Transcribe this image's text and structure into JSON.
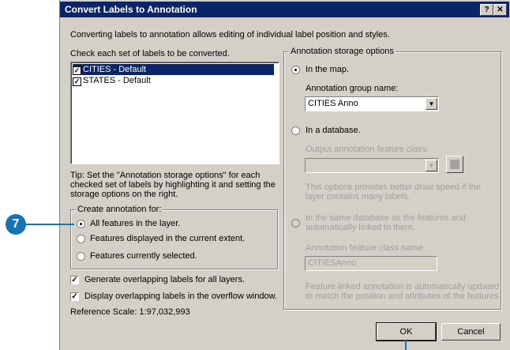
{
  "window": {
    "title": "Convert Labels to Annotation",
    "help_glyph": "?",
    "close_glyph": "✕"
  },
  "intro": "Converting labels to annotation allows editing of individual label position and styles.",
  "check_label": "Check each set of labels to be converted.",
  "layers": [
    {
      "label": "CITIES - Default",
      "checked": true,
      "selected": true
    },
    {
      "label": "STATES - Default",
      "checked": true,
      "selected": false
    }
  ],
  "tip": [
    "Tip:  Set the \"Annotation storage options\" for each",
    "checked set of labels by highlighting it and setting the",
    "storage options on the right."
  ],
  "create_group": {
    "legend": "Create annotation for:",
    "options": [
      "All features in the layer.",
      "Features displayed in the current extent.",
      "Features currently selected."
    ]
  },
  "checks": {
    "overlap_all": "Generate overlapping labels for all layers.",
    "overlap_window": "Display overlapping labels in the overflow window."
  },
  "reference_scale": "Reference Scale:   1:97,032,993",
  "storage": {
    "legend": "Annotation storage options",
    "in_map": "In the map.",
    "group_name_label": "Annotation group name:",
    "group_name_value": "CITIES Anno",
    "in_database": "In a database.",
    "output_class_label": "Output annotation feature class:",
    "db_note": [
      "This options provides better draw speed if the",
      "layer contains many labels."
    ],
    "same_db": [
      "In the same database as the features and",
      "automatically linked to them."
    ],
    "class_name_label": "Annotation feature class name:",
    "class_name_value": "CITIESAnno",
    "linked_note": [
      "Feature linked annotation is automatically updated",
      "to match the position and attributes of the features."
    ]
  },
  "buttons": {
    "ok": "OK",
    "cancel": "Cancel"
  },
  "callout": "7",
  "colors": {
    "titlebar": "#0a246a",
    "dialog": "#d4d0c8",
    "callout": "#1673b5"
  }
}
